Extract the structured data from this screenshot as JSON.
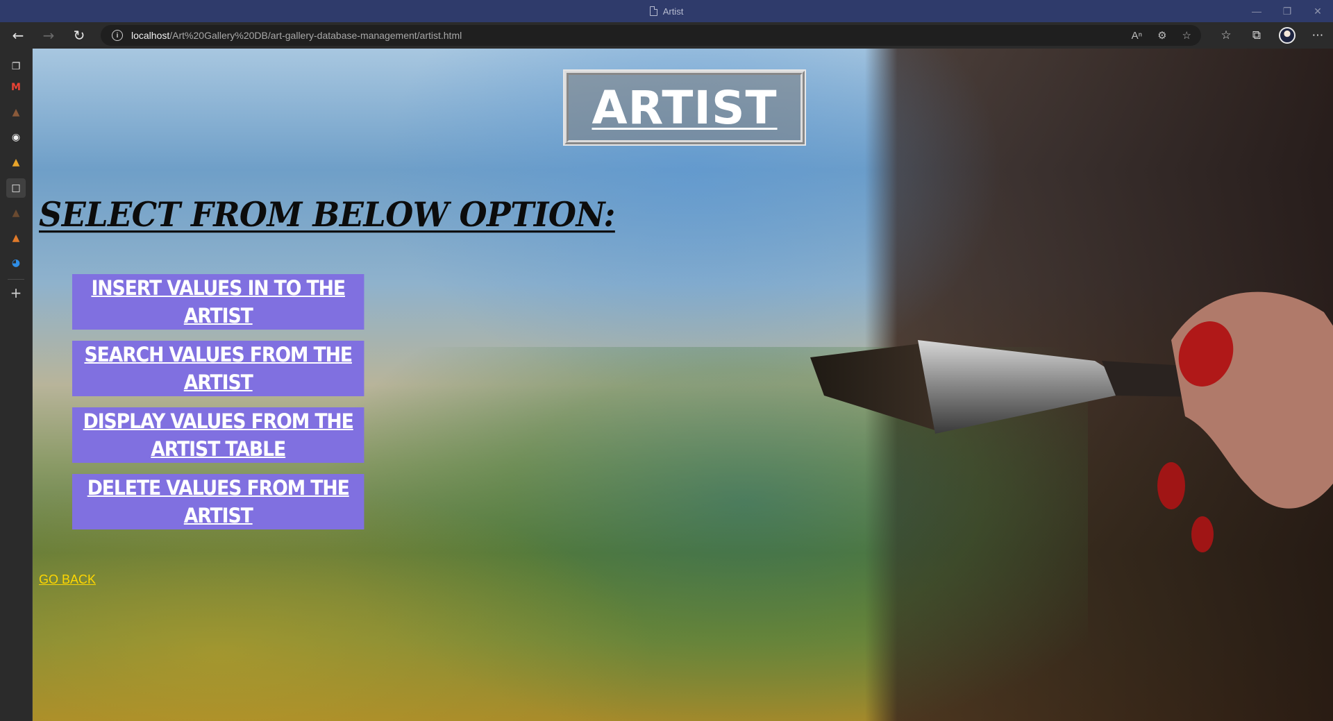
{
  "window": {
    "title": "Artist"
  },
  "browser": {
    "url_host": "localhost",
    "url_path": "/Art%20Gallery%20DB/art-gallery-database-management/artist.html"
  },
  "page": {
    "heading": "ARTIST",
    "subheading": "SELECT FROM BELOW OPTION:",
    "options": [
      {
        "label": "INSERT VALUES IN TO THE ARTIST"
      },
      {
        "label": "SEARCH VALUES FROM THE ARTIST"
      },
      {
        "label": "DISPLAY VALUES FROM THE ARTIST TABLE"
      },
      {
        "label": "DELETE VALUES FROM THE ARTIST"
      }
    ],
    "go_back": "GO BACK"
  },
  "colors": {
    "option_button_bg": "#8070e0",
    "go_back_link": "#ffd700",
    "title_bar_bg": "#2f3b6b"
  },
  "icons": {
    "sidebar": [
      "tabs-icon",
      "gmail-icon",
      "app-icon",
      "github-icon",
      "app-icon",
      "document-icon",
      "app-icon",
      "app-icon",
      "edge-icon",
      "add-icon"
    ],
    "toolbar": [
      "back-icon",
      "forward-icon",
      "refresh-icon",
      "info-icon",
      "read-aloud-icon",
      "translate-icon",
      "add-favorite-icon",
      "favorites-icon",
      "collections-icon",
      "profile-avatar",
      "more-icon"
    ]
  }
}
